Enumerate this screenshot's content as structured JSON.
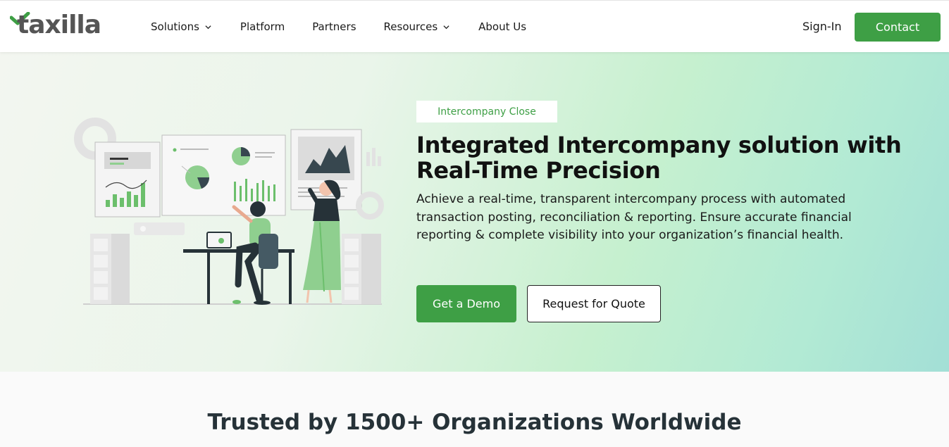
{
  "brand": {
    "name": "taxilla",
    "accent": "#3e9f45"
  },
  "nav": {
    "items": [
      {
        "label": "Solutions",
        "has_dropdown": true
      },
      {
        "label": "Platform",
        "has_dropdown": false
      },
      {
        "label": "Partners",
        "has_dropdown": false
      },
      {
        "label": "Resources",
        "has_dropdown": true
      },
      {
        "label": "About Us",
        "has_dropdown": false
      }
    ],
    "signin_label": "Sign-In",
    "contact_label": "Contact"
  },
  "hero": {
    "tag": "Intercompany Close",
    "title_line1": "Integrated Intercompany solution with",
    "title_line2": "Real-Time Precision",
    "description": "Achieve a real-time, transparent intercompany process with automated transaction posting, reconciliation & reporting. Ensure accurate financial reporting & complete visibility into your organization’s financial health.",
    "demo_label": "Get a Demo",
    "quote_label": "Request for Quote"
  },
  "trusted": {
    "heading": "Trusted by 1500+ Organizations Worldwide"
  }
}
